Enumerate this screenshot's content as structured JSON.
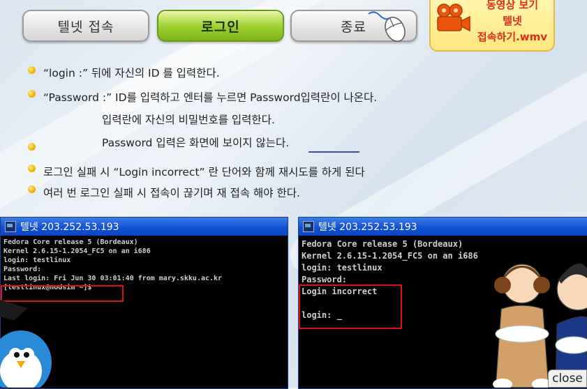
{
  "tabs": [
    {
      "label": "텔넷 접속"
    },
    {
      "label": "로그인"
    },
    {
      "label": "종료"
    }
  ],
  "video_button": {
    "lines": [
      "동영상 보기",
      "텔넷",
      "접속하기.wmv"
    ]
  },
  "instructions": [
    "“login :” 뒤에 자신의 ID 를 입력한다.",
    "“Password :” ID를 입력하고 엔터를 누르면 Password입력란이 나온다.",
    "입력란에 자신의 비밀번호를 입력한다.",
    "Password 입력은 화면에 보이지 않는다.",
    "로그인 실패 시 “Login incorrect” 란 단어와 함께 재시도를 하게 된다",
    "여러 번 로그인 실패 시 접속이 끊기며 재 접속 해야 한다."
  ],
  "terminal_left": {
    "title": "텔넷 203.252.53.193",
    "lines": [
      "Fedora Core release 5 (Bordeaux)",
      "Kernel 2.6.15-1.2054_FC5 on an i686",
      "login: testlinux",
      "Password:",
      "Last login: Fri Jun 30 03:01:40 from mary.skku.ac.kr",
      "[testlinux@nodsim ~]$"
    ]
  },
  "terminal_right": {
    "title": "텔넷 203.252.53.193",
    "lines": [
      "Fedora Core release 5 (Bordeaux)",
      "Kernel 2.6.15-1.2054_FC5 on an i686",
      "login: testlinux",
      "Password:",
      "Login incorrect",
      "",
      "login: _"
    ]
  },
  "close_label": "close",
  "colors": {
    "accent_green": "#9bcf2c",
    "title_blue": "#0f4fd0",
    "highlight_red": "#e01010"
  }
}
